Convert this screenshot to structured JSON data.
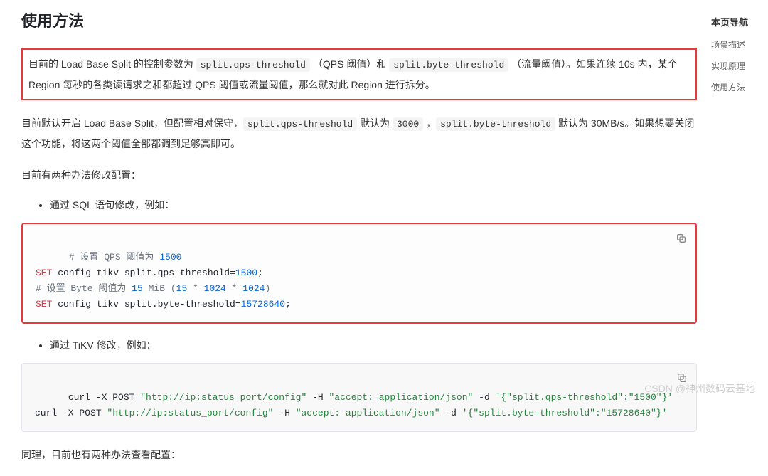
{
  "toc": {
    "title": "本页导航",
    "items": [
      "场景描述",
      "实现原理",
      "使用方法"
    ]
  },
  "heading": "使用方法",
  "para1": {
    "t1": "目前的 Load Base Split 的控制参数为 ",
    "c1": "split.qps-threshold",
    "t2": " （QPS 阈值）和 ",
    "c2": "split.byte-threshold",
    "t3": " （流量阈值）。如果连续 10s 内，某个 Region 每秒的各类读请求之和都超过 QPS 阈值或流量阈值，那么就对此 Region 进行拆分。"
  },
  "para2": {
    "t1": "目前默认开启 Load Base Split，但配置相对保守，",
    "c1": "split.qps-threshold",
    "t2": " 默认为 ",
    "c2": "3000",
    "t3": " ，",
    "c3": "split.byte-threshold",
    "t4": " 默认为 30MB/s。如果想要关闭这个功能，将这两个阈值全部都调到足够高即可。"
  },
  "para3": "目前有两种办法修改配置：",
  "bullet1": "通过 SQL 语句修改，例如：",
  "bullet2": "通过 TiKV 修改，例如：",
  "code1": {
    "l1a": "# 设置 QPS 阈值为 ",
    "l1b": "1500",
    "l2a": "SET",
    "l2b": " config tikv split.qps-threshold=",
    "l2c": "1500",
    "l2d": ";",
    "l3a": "# 设置 Byte 阈值为 ",
    "l3b": "15",
    "l3c": " MiB (",
    "l3d": "15",
    "l3e": " * ",
    "l3f": "1024",
    "l3g": " * ",
    "l3h": "1024",
    "l3i": ")",
    "l4a": "SET",
    "l4b": " config tikv split.byte-threshold=",
    "l4c": "15728640",
    "l4d": ";"
  },
  "code2": {
    "l1a": "curl -X POST ",
    "l1b": "\"http://ip:status_port/config\"",
    "l1c": " -H ",
    "l1d": "\"accept: application/json\"",
    "l1e": " -d ",
    "l1f": "'{\"split.qps-threshold\":\"1500\"}'",
    "l2a": "curl -X POST ",
    "l2b": "\"http://ip:status_port/config\"",
    "l2c": " -H ",
    "l2d": "\"accept: application/json\"",
    "l2e": " -d ",
    "l2f": "'{\"split.byte-threshold\":\"15728640\"}'"
  },
  "para4": "同理，目前也有两种办法查看配置：",
  "watermark": "CSDN @神州数码云基地"
}
